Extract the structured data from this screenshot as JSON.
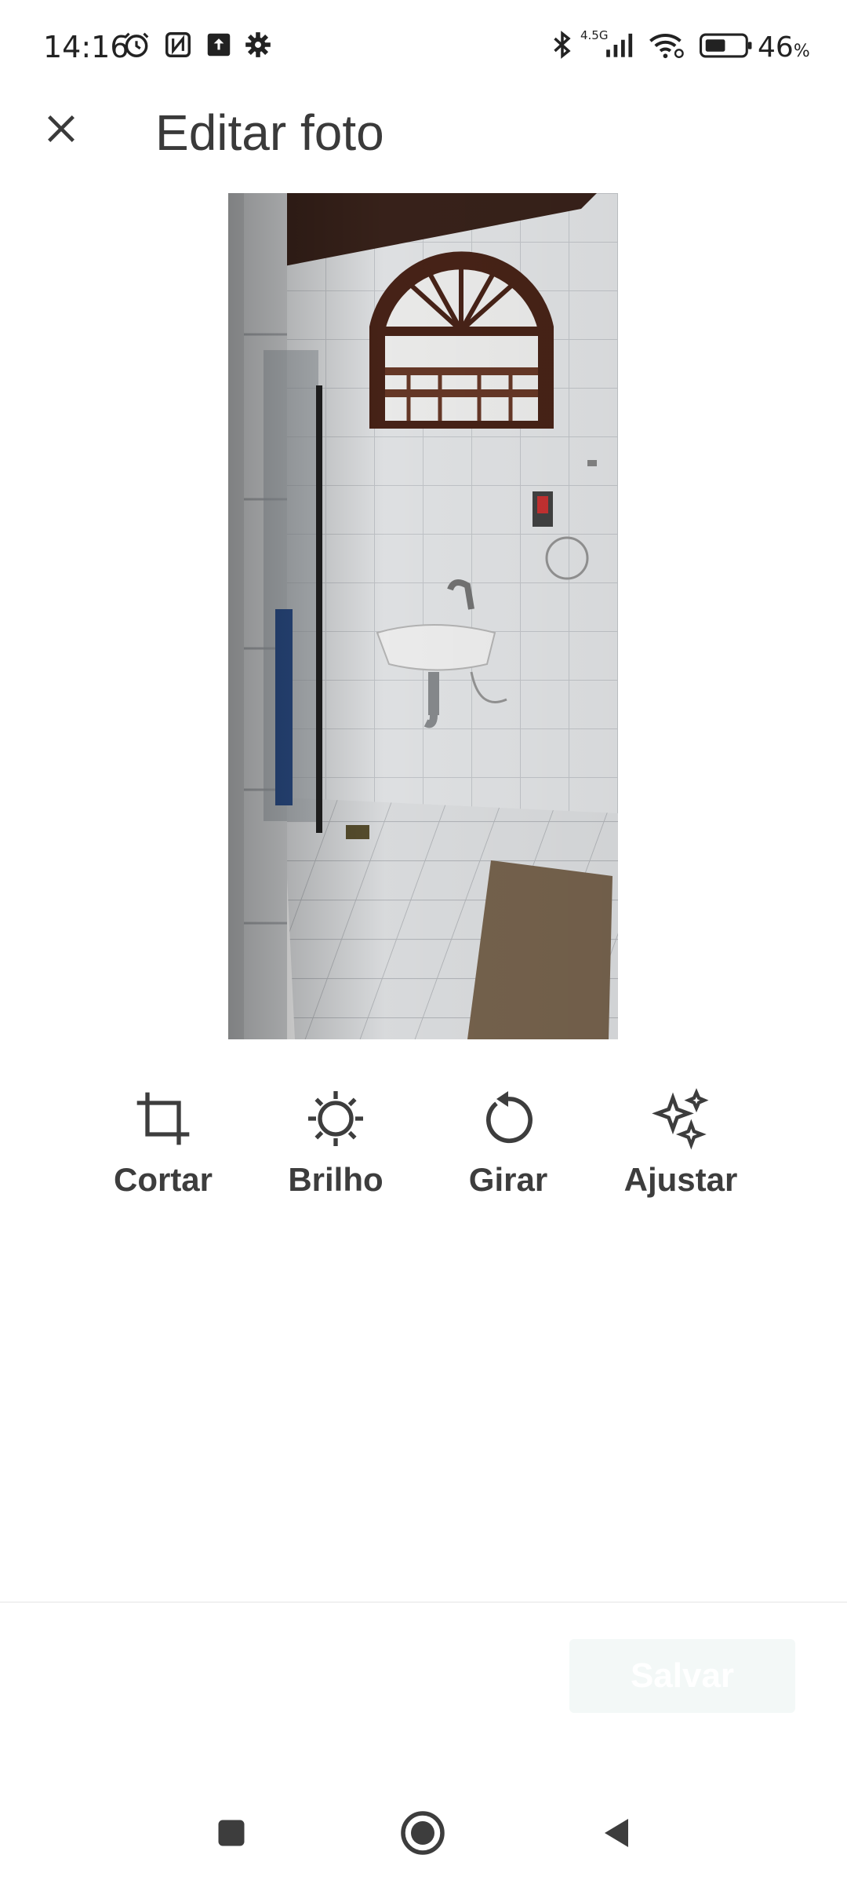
{
  "status_bar": {
    "time": "14:16",
    "network": "4.5G",
    "battery_percent": "46",
    "battery_unit": "%",
    "icons": [
      "alarm-icon",
      "nfc-icon",
      "upload-icon",
      "settings-icon",
      "bluetooth-icon",
      "signal-icon",
      "wifi-icon",
      "battery-icon"
    ]
  },
  "header": {
    "close_icon": "close-icon",
    "title": "Editar foto"
  },
  "tools": [
    {
      "label": "Cortar",
      "icon": "crop-icon"
    },
    {
      "label": "Brilho",
      "icon": "brightness-icon"
    },
    {
      "label": "Girar",
      "icon": "rotate-icon"
    },
    {
      "label": "Ajustar",
      "icon": "sparkle-icon"
    }
  ],
  "footer": {
    "save_label": "Salvar"
  },
  "nav": {
    "icons": [
      "recent-apps-icon",
      "home-icon",
      "back-icon"
    ]
  },
  "colors": {
    "text": "#3d3d3d",
    "save_bg": "#f3f8f7",
    "background": "#ffffff"
  }
}
